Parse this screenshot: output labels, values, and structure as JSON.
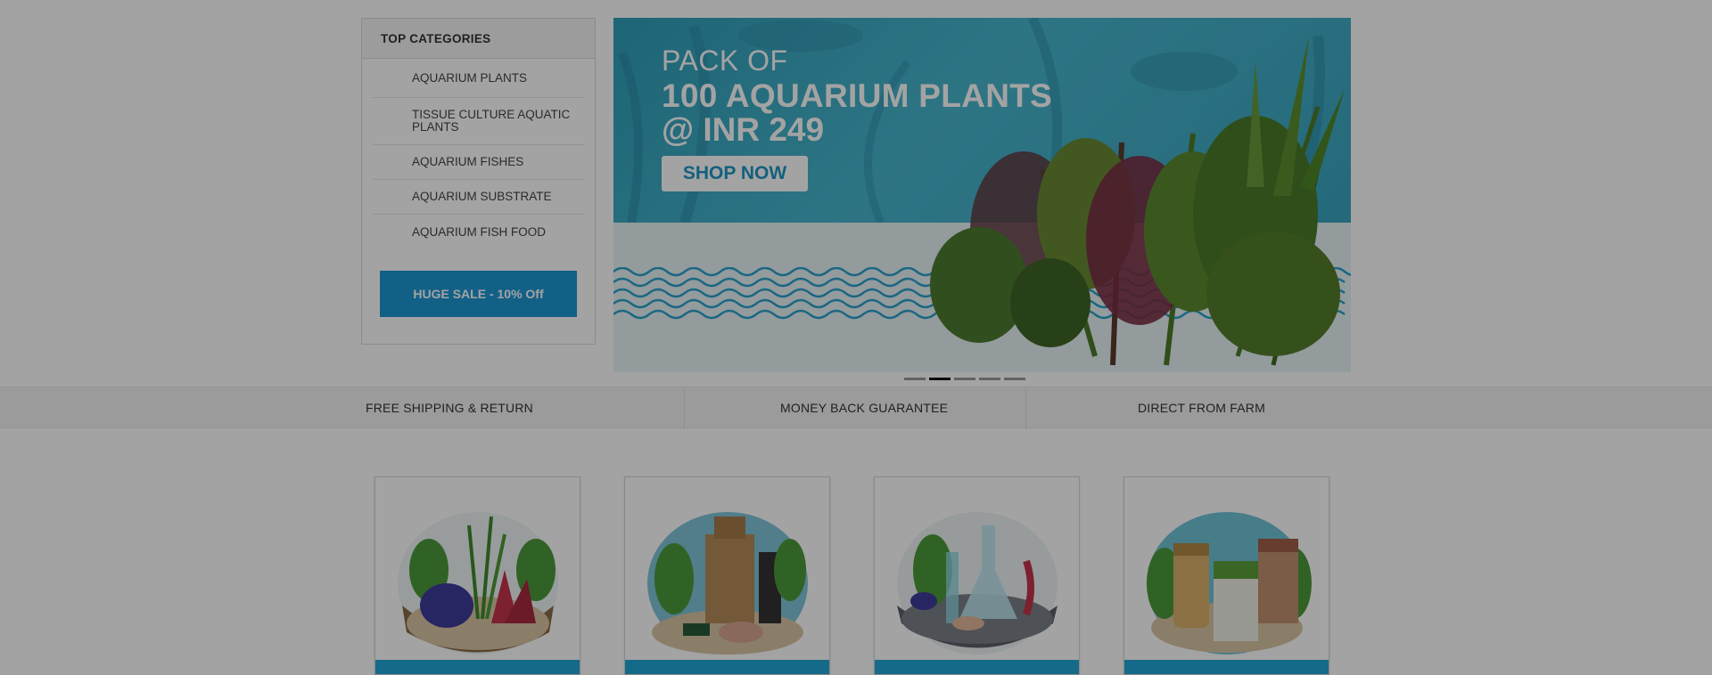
{
  "sidebar": {
    "heading": "TOP CATEGORIES",
    "items": [
      {
        "label": "AQUARIUM PLANTS"
      },
      {
        "label": "TISSUE CULTURE AQUATIC PLANTS"
      },
      {
        "label": "AQUARIUM FISHES"
      },
      {
        "label": "AQUARIUM SUBSTRATE"
      },
      {
        "label": "AQUARIUM FISH FOOD"
      }
    ],
    "sale_button": "HUGE SALE - 10% Off"
  },
  "banner": {
    "line1": "PACK OF",
    "line2": "100 AQUARIUM PLANTS",
    "line3": "@ INR 249",
    "cta": "SHOP NOW",
    "slide_count": 5,
    "active_slide": 2
  },
  "features": [
    {
      "label": "FREE SHIPPING & RETURN"
    },
    {
      "label": "MONEY BACK GUARANTEE"
    },
    {
      "label": "DIRECT FROM FARM"
    }
  ],
  "cards": [
    {
      "icon": "plants-illustration-icon"
    },
    {
      "icon": "decor-castle-illustration-icon"
    },
    {
      "icon": "lab-flask-illustration-icon"
    },
    {
      "icon": "fish-food-illustration-icon"
    }
  ],
  "colors": {
    "accent": "#1e97d4",
    "overlay": "rgba(0,0,0,0.36)"
  }
}
